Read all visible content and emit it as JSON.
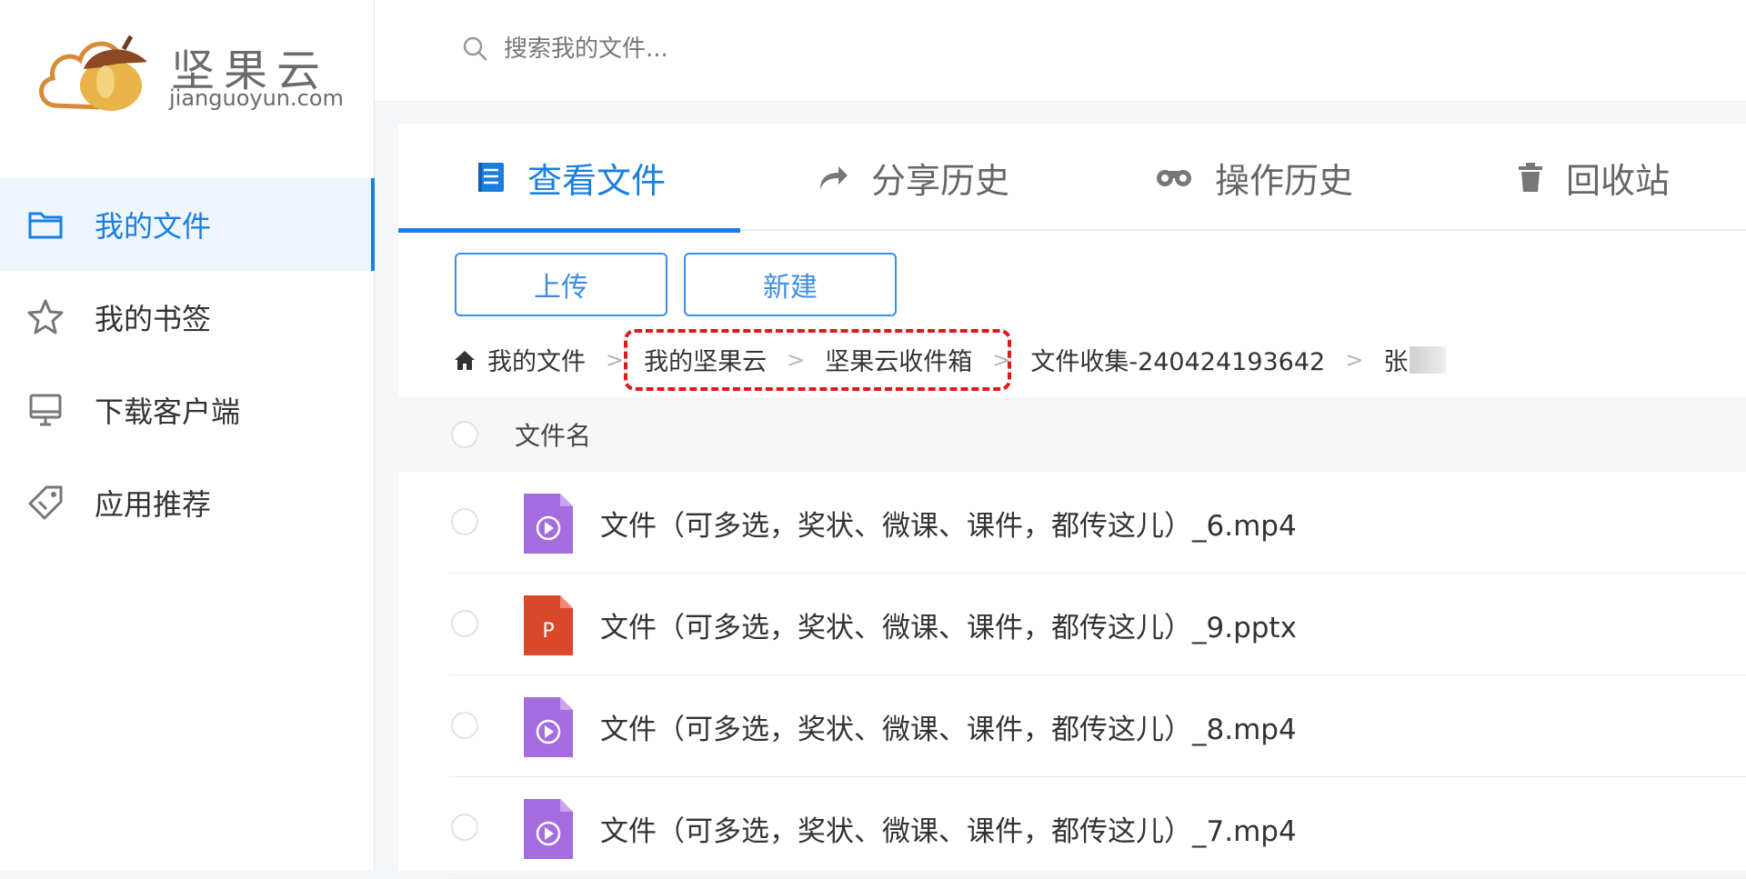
{
  "brand": {
    "name": "坚果云",
    "domain": "jianguoyun.com"
  },
  "search": {
    "placeholder": "搜索我的文件..."
  },
  "sidebar": {
    "items": [
      {
        "label": "我的文件",
        "icon": "folder-icon",
        "active": true
      },
      {
        "label": "我的书签",
        "icon": "star-icon"
      },
      {
        "label": "下载客户端",
        "icon": "monitor-icon"
      },
      {
        "label": "应用推荐",
        "icon": "tag-icon"
      }
    ]
  },
  "tabs": [
    {
      "label": "查看文件",
      "icon": "document-icon",
      "active": true
    },
    {
      "label": "分享历史",
      "icon": "share-icon"
    },
    {
      "label": "操作历史",
      "icon": "binoculars-icon"
    },
    {
      "label": "回收站",
      "icon": "trash-icon"
    }
  ],
  "toolbar": {
    "upload_label": "上传",
    "new_label": "新建"
  },
  "breadcrumb": {
    "items": [
      "我的文件",
      "我的坚果云",
      "坚果云收件箱",
      "文件收集-240424193642",
      "张"
    ],
    "separator": ">"
  },
  "table": {
    "column_name": "文件名",
    "rows": [
      {
        "name": "文件（可多选，奖状、微课、课件，都传这儿）_6.mp4",
        "type": "video"
      },
      {
        "name": "文件（可多选，奖状、微课、课件，都传这儿）_9.pptx",
        "type": "ppt",
        "badge": "P"
      },
      {
        "name": "文件（可多选，奖状、微课、课件，都传这儿）_8.mp4",
        "type": "video"
      },
      {
        "name": "文件（可多选，奖状、微课、课件，都传这儿）_7.mp4",
        "type": "video"
      }
    ]
  },
  "colors": {
    "accent": "#1a7fe0",
    "video_icon": "#a56ce0",
    "ppt_icon": "#d9482b",
    "highlight": "#e01a1a"
  }
}
